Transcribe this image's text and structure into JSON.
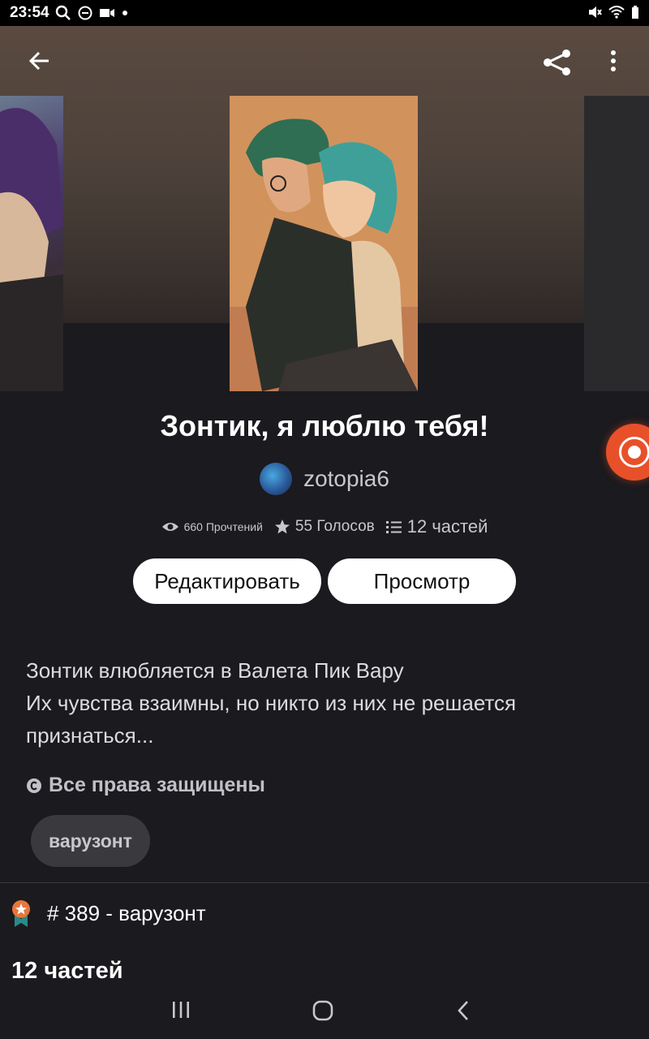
{
  "status_bar": {
    "time": "23:54",
    "left_icons": [
      "search-icon",
      "do-not-disturb-icon",
      "video-icon",
      "dot-icon"
    ],
    "right_icons": [
      "mute-icon",
      "wifi-icon",
      "battery-icon"
    ]
  },
  "header": {
    "back_icon": "back-arrow-icon",
    "share_icon": "share-icon",
    "more_icon": "more-vert-icon"
  },
  "story": {
    "title": "Зонтик, я люблю тебя!",
    "author": "zotopia6",
    "stats": {
      "reads": "660 Прочтений",
      "votes": "55 Голосов",
      "parts": "12 частей"
    },
    "buttons": {
      "edit": "Редактировать",
      "view": "Просмотр"
    },
    "description_lines": [
      "Зонтик влюбляется в Валета Пик Вару",
      "Их чувства взаимны, но никто из них не решается",
      "признаться..."
    ],
    "rights": "Все права защищены",
    "tag": "варузонт",
    "rank": "# 389 - варузонт",
    "parts_heading": "12 частей"
  },
  "colors": {
    "background": "#1b1a1e",
    "accent_float": "#e8502a",
    "rank_badge": "#e8763a"
  }
}
